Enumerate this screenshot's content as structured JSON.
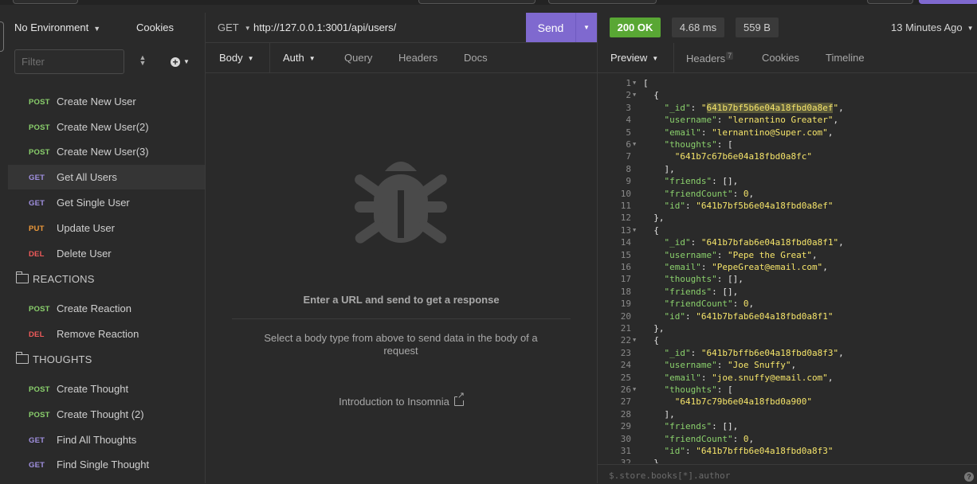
{
  "sidebar": {
    "environment": "No Environment",
    "cookies": "Cookies",
    "filter_placeholder": "Filter",
    "requests_top": [
      {
        "method": "POST",
        "name": "Create New User"
      },
      {
        "method": "POST",
        "name": "Create New User(2)"
      },
      {
        "method": "POST",
        "name": "Create New User(3)"
      },
      {
        "method": "GET",
        "name": "Get All Users"
      },
      {
        "method": "GET",
        "name": "Get Single User"
      },
      {
        "method": "PUT",
        "name": "Update User"
      },
      {
        "method": "DEL",
        "name": "Delete User"
      }
    ],
    "folders": [
      {
        "name": "REACTIONS",
        "requests": [
          {
            "method": "POST",
            "name": "Create Reaction"
          },
          {
            "method": "DEL",
            "name": "Remove Reaction"
          }
        ]
      },
      {
        "name": "THOUGHTS",
        "requests": [
          {
            "method": "POST",
            "name": "Create Thought"
          },
          {
            "method": "POST",
            "name": "Create Thought (2)"
          },
          {
            "method": "GET",
            "name": "Find All Thoughts"
          },
          {
            "method": "GET",
            "name": "Find Single Thought"
          }
        ]
      }
    ]
  },
  "request": {
    "method": "GET",
    "url": "http://127.0.0.1:3001/api/users/",
    "send_label": "Send",
    "tabs": [
      "Body",
      "Auth",
      "Query",
      "Headers",
      "Docs"
    ],
    "empty_title": "Enter a URL and send to get a response",
    "empty_sub": "Select a body type from above to send data in the body of a request",
    "intro_link": "Introduction to Insomnia"
  },
  "response": {
    "status": "200 OK",
    "time": "4.68 ms",
    "size": "559 B",
    "ago": "13 Minutes Ago",
    "tabs": {
      "preview": "Preview",
      "headers": "Headers",
      "headers_count": "7",
      "cookies": "Cookies",
      "timeline": "Timeline"
    },
    "filter_placeholder": "$.store.books[*].author",
    "lines": [
      "[",
      "  {",
      "    \"_id\": \"641b7bf5b6e04a18fbd0a8ef\",",
      "    \"username\": \"lernantino Greater\",",
      "    \"email\": \"lernantino@Super.com\",",
      "    \"thoughts\": [",
      "      \"641b7c67b6e04a18fbd0a8fc\"",
      "    ],",
      "    \"friends\": [],",
      "    \"friendCount\": 0,",
      "    \"id\": \"641b7bf5b6e04a18fbd0a8ef\"",
      "  },",
      "  {",
      "    \"_id\": \"641b7bfab6e04a18fbd0a8f1\",",
      "    \"username\": \"Pepe the Great\",",
      "    \"email\": \"PepeGreat@email.com\",",
      "    \"thoughts\": [],",
      "    \"friends\": [],",
      "    \"friendCount\": 0,",
      "    \"id\": \"641b7bfab6e04a18fbd0a8f1\"",
      "  },",
      "  {",
      "    \"_id\": \"641b7bffb6e04a18fbd0a8f3\",",
      "    \"username\": \"Joe Snuffy\",",
      "    \"email\": \"joe.snuffy@email.com\",",
      "    \"thoughts\": [",
      "      \"641b7c79b6e04a18fbd0a900\"",
      "    ],",
      "    \"friends\": [],",
      "    \"friendCount\": 0,",
      "    \"id\": \"641b7bffb6e04a18fbd0a8f3\"",
      "  },"
    ],
    "fold_lines": [
      1,
      2,
      6,
      13,
      22,
      26
    ]
  },
  "colors": {
    "accent": "#7f69cf",
    "status_ok": "#59a734",
    "post": "#8ad06c",
    "get": "#a090e0",
    "put": "#ef9a3a",
    "del": "#ef5a5a"
  }
}
